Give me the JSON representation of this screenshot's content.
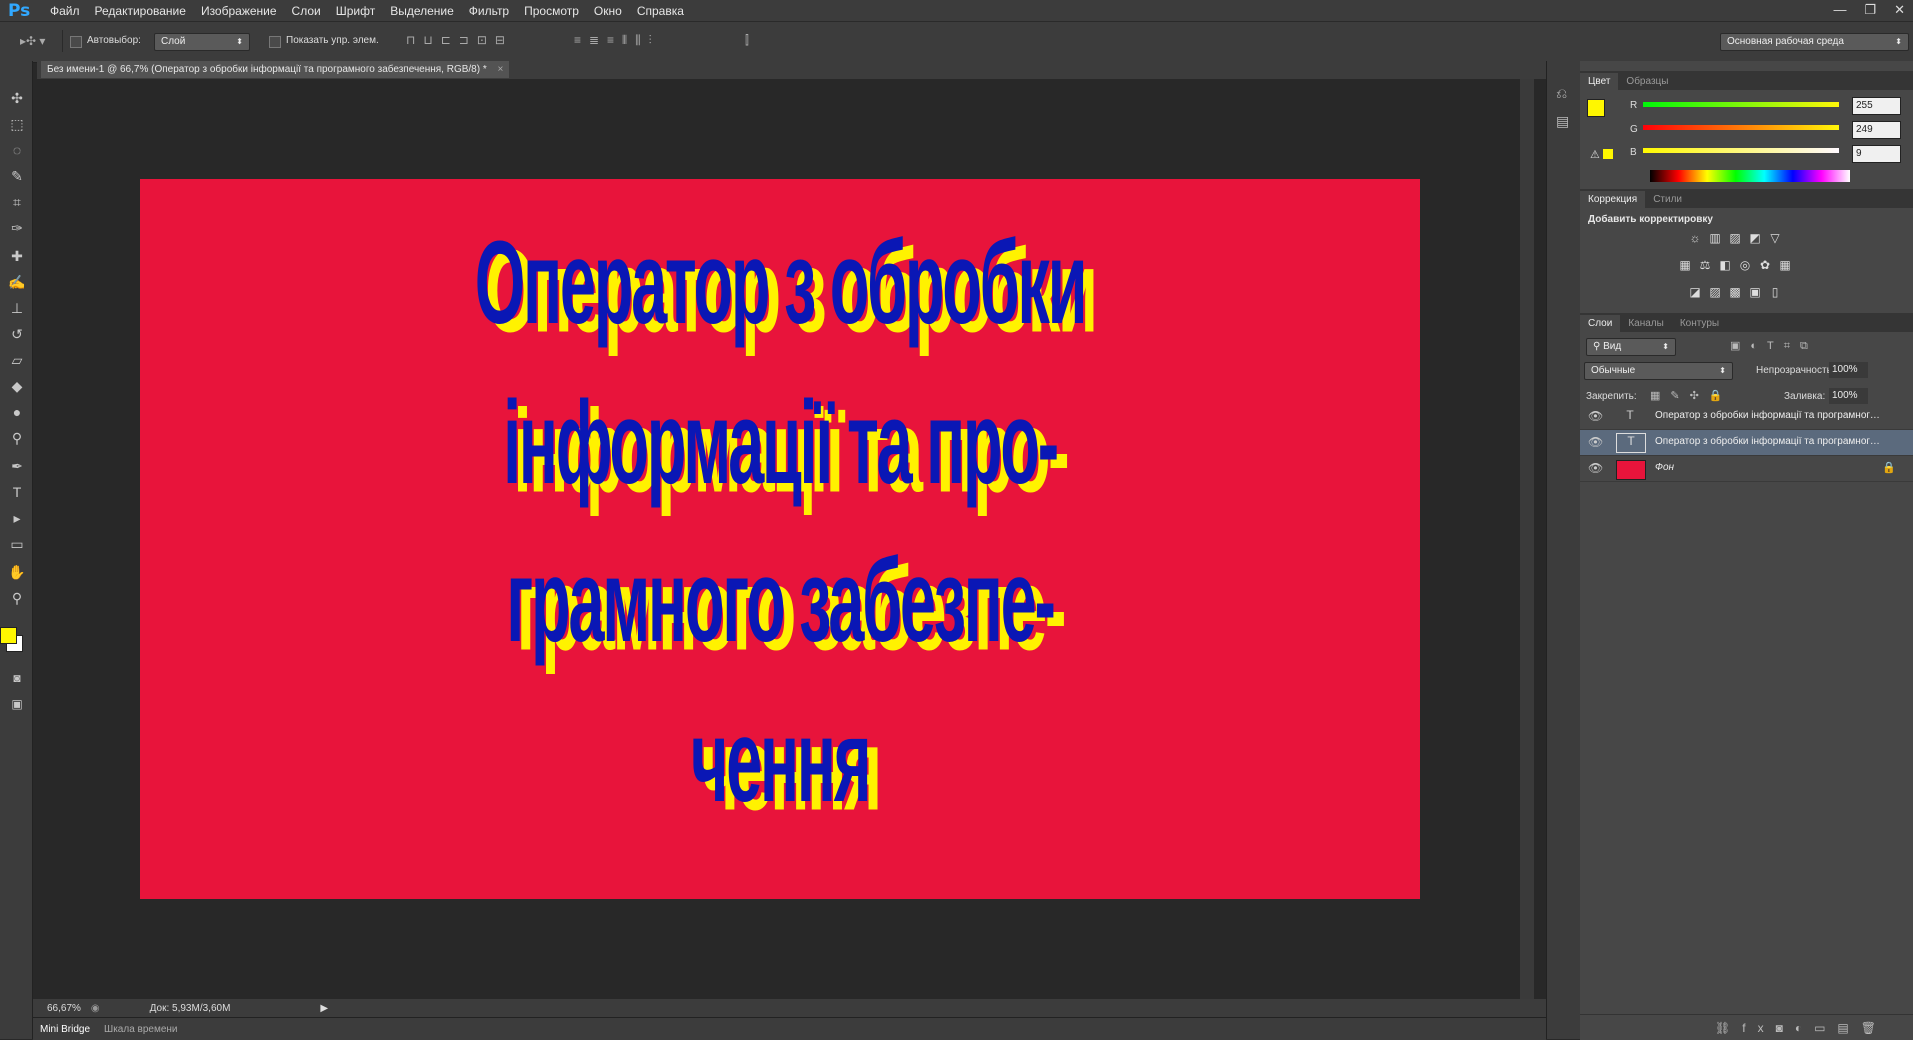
{
  "app": {
    "logo": "Ps",
    "menu": [
      "Файл",
      "Редактирование",
      "Изображение",
      "Слои",
      "Шрифт",
      "Выделение",
      "Фильтр",
      "Просмотр",
      "Окно",
      "Справка"
    ],
    "window_controls": [
      "—",
      "❐",
      "✕"
    ]
  },
  "options": {
    "autoselect_label": "Автовыбор:",
    "autoselect_value": "Слой",
    "show_transform_label": "Показать упр. элем.",
    "workspace": "Основная рабочая среда"
  },
  "document": {
    "tab_title": "Без имени-1 @ 66,7% (Оператор з обробки інформації та програмного забезпечення, RGB/8) *",
    "lines": [
      "Оператор з обробки",
      "інформації та про-",
      "грамного забезпе-",
      "чення"
    ],
    "bg_color": "#e8143b",
    "text_color": "#0a17b5",
    "shadow_color": "#fff200"
  },
  "status": {
    "zoom": "66,67%",
    "doc_info": "Док: 5,93M/3,60M",
    "bottom_tabs": [
      "Mini Bridge",
      "Шкала времени"
    ]
  },
  "color_panel": {
    "tabs": [
      "Цвет",
      "Образцы"
    ],
    "r_label": "R",
    "r_value": "255",
    "g_label": "G",
    "g_value": "249",
    "b_label": "B",
    "b_value": "9",
    "foreground": "#fff700"
  },
  "adjust_panel": {
    "tabs": [
      "Коррекция",
      "Стили"
    ],
    "title": "Добавить корректировку"
  },
  "layers_panel": {
    "tabs": [
      "Слои",
      "Каналы",
      "Контуры"
    ],
    "filter": "Вид",
    "blend": "Обычные",
    "opacity_label": "Непрозрачность:",
    "opacity": "100%",
    "lock_label": "Закрепить:",
    "fill_label": "Заливка:",
    "fill": "100%",
    "layers": [
      {
        "name": "Оператор з обробки інформації та програмного…",
        "type": "text"
      },
      {
        "name": "Оператор з обробки інформації та програмного…",
        "type": "text",
        "selected": true
      },
      {
        "name": "Фон",
        "type": "background"
      }
    ]
  }
}
